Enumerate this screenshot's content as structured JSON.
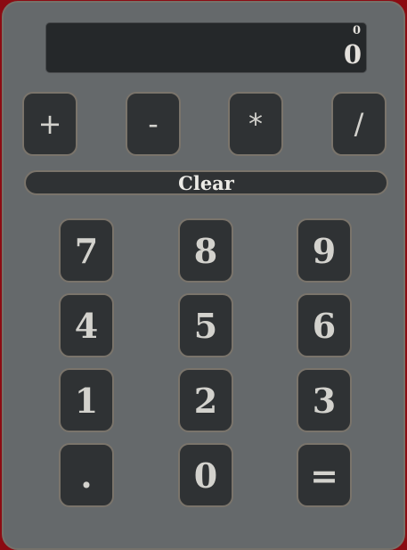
{
  "display": {
    "previous": "0",
    "current": "0"
  },
  "operators": {
    "add": "+",
    "subtract": "-",
    "multiply": "*",
    "divide": "/"
  },
  "clear_label": "Clear",
  "keypad": {
    "seven": "7",
    "eight": "8",
    "nine": "9",
    "four": "4",
    "five": "5",
    "six": "6",
    "one": "1",
    "two": "2",
    "three": "3",
    "decimal": ".",
    "zero": "0",
    "equals": "="
  },
  "colors": {
    "page_background": "#8b0b12",
    "calculator_body": "#65696b",
    "button_background": "#2f3234",
    "button_border": "#7a746b",
    "display_background": "#25282a",
    "text": "#d3d2cd"
  }
}
